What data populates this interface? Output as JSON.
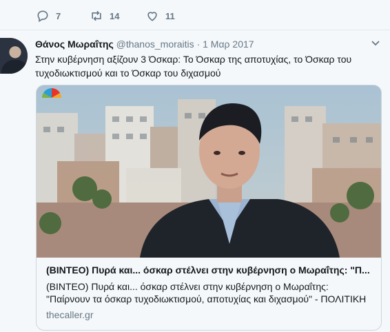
{
  "actions": {
    "reply_count": "7",
    "retweet_count": "14",
    "like_count": "11"
  },
  "tweet": {
    "author_name": "Θάνος Μωραΐτης",
    "handle": "@thanos_moraitis",
    "separator": "·",
    "date": "1 Μαρ 2017",
    "text": "Στην κυβέρνηση  αξίζουν 3 Όσκαρ: Το Όσκαρ της αποτυχίας, το Όσκαρ του τυχοδιωκτισμού και το Όσκαρ του διχασμού"
  },
  "card": {
    "title": "(ΒΙΝΤΕΟ) Πυρά και... όσκαρ στέλνει στην κυβέρνηση ο Μωραΐτης: \"Π...",
    "description": "(ΒΙΝΤΕΟ) Πυρά και... όσκαρ στέλνει στην κυβέρνηση ο Μωραΐτης: \"Παίρνουν τα όσκαρ τυχοδιωκτισμού, αποτυχίας και διχασμού\" - ΠΟΛΙΤΙΚΗ",
    "domain": "thecaller.gr"
  },
  "icons": {
    "reply": "reply-icon",
    "retweet": "retweet-icon",
    "like": "heart-icon",
    "more": "chevron-down-icon"
  },
  "colors": {
    "text_secondary": "#657786",
    "text_primary": "#14171a",
    "border": "#ccd6dd",
    "background": "#f5f8fa"
  }
}
